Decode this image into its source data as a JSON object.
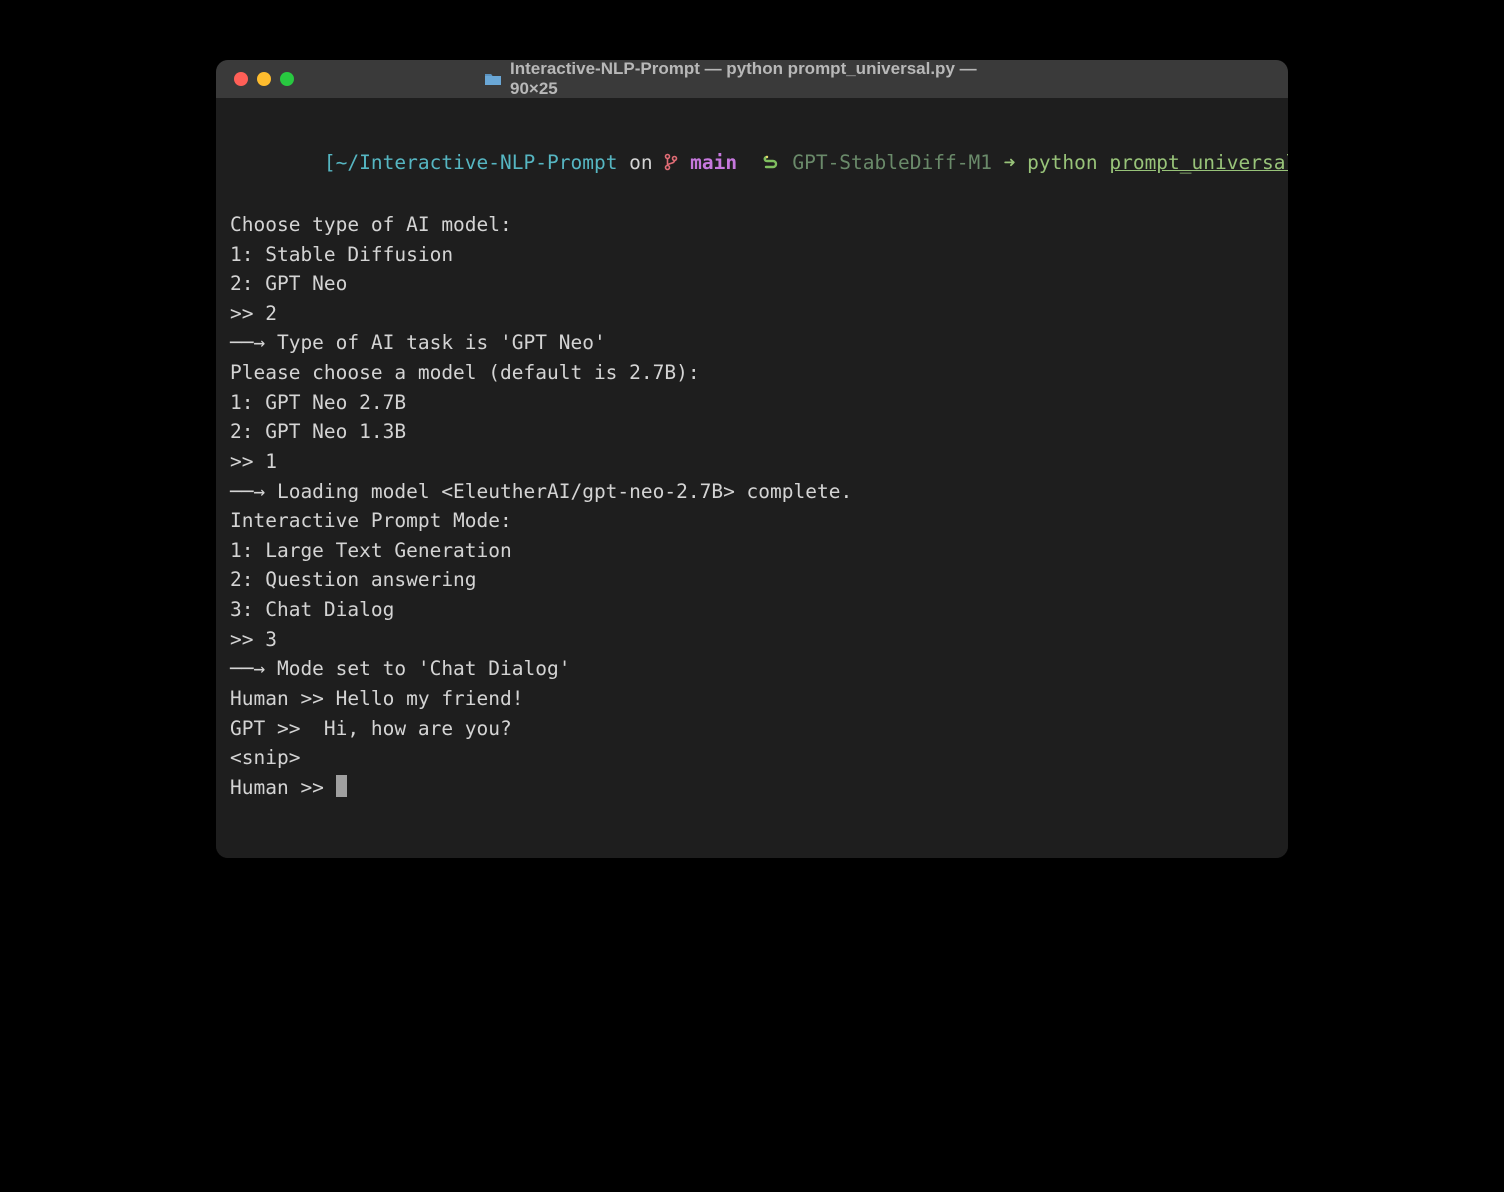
{
  "titlebar": {
    "title": "Interactive-NLP-Prompt — python prompt_universal.py — 90×25"
  },
  "prompt": {
    "open_bracket": "[",
    "path": "~/Interactive-NLP-Prompt",
    "on_word": " on ",
    "branch": "main",
    "env_name": " GPT-StableDiff-M1 ",
    "arrow": "➜",
    "command_prefix": " python ",
    "command_file": "prompt_universal.py",
    "close_bracket": "]"
  },
  "lines": {
    "l1": "Choose type of AI model:",
    "l2": "1: Stable Diffusion",
    "l3": "2: GPT Neo",
    "l4": ">> 2",
    "l5": "──→ Type of AI task is 'GPT Neo'",
    "l6": "Please choose a model (default is 2.7B):",
    "l7": "1: GPT Neo 2.7B",
    "l8": "2: GPT Neo 1.3B",
    "l9": ">> 1",
    "l10": "──→ Loading model <EleutherAI/gpt-neo-2.7B> complete.",
    "l11": "Interactive Prompt Mode:",
    "l12": "1: Large Text Generation",
    "l13": "2: Question answering",
    "l14": "3: Chat Dialog",
    "l15": ">> 3",
    "l16": "──→ Mode set to 'Chat Dialog'",
    "l17": "",
    "l18": "Human >> Hello my friend!",
    "l19": "GPT >>  Hi, how are you?",
    "l20": "<snip>",
    "l21": "",
    "l22_prefix": "Human >> "
  }
}
